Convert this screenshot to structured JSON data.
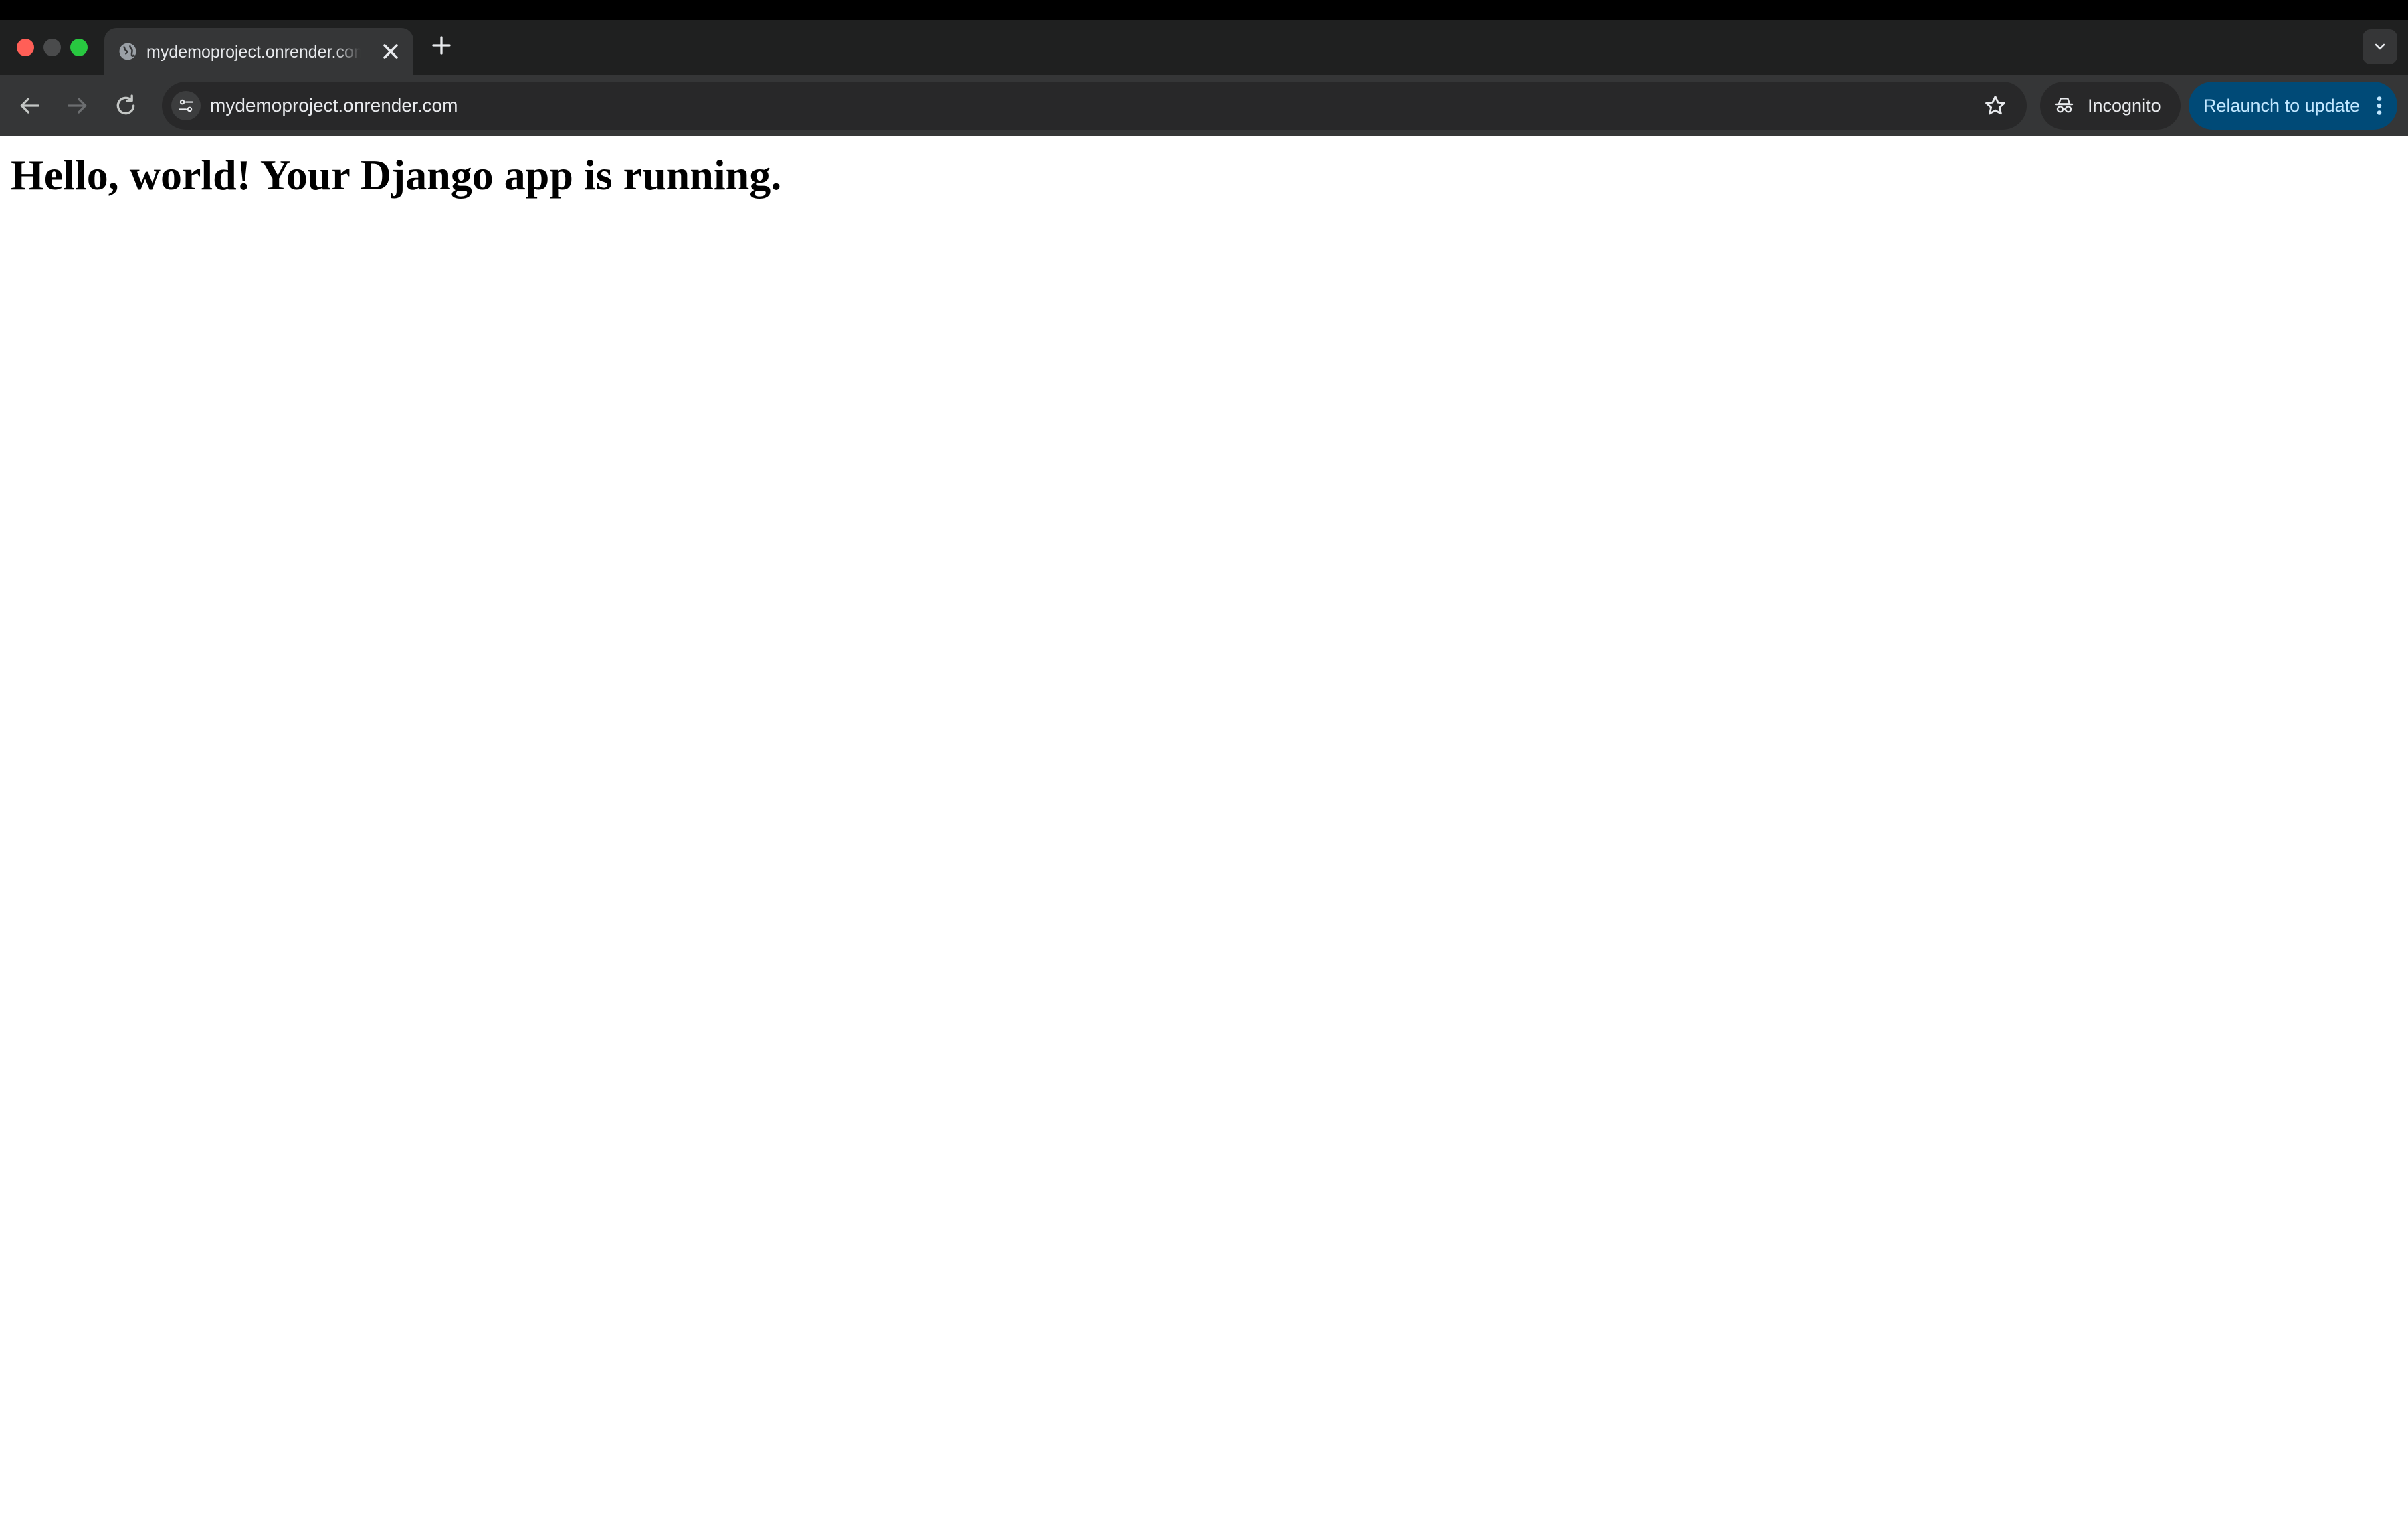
{
  "browser": {
    "tab": {
      "title": "mydemoproject.onrender.com",
      "favicon": "globe-icon"
    },
    "toolbar": {
      "url": "mydemoproject.onrender.com",
      "incognito_label": "Incognito",
      "relaunch_label": "Relaunch to update"
    },
    "colors": {
      "tab_strip": "#1f2020",
      "toolbar": "#353637",
      "omnibox": "#282829",
      "relaunch_bg": "#004a77",
      "relaunch_text": "#c2e7ff",
      "close_light": "#ff5f57",
      "maximize_light": "#28c840"
    }
  },
  "page": {
    "heading": "Hello, world! Your Django app is running."
  }
}
